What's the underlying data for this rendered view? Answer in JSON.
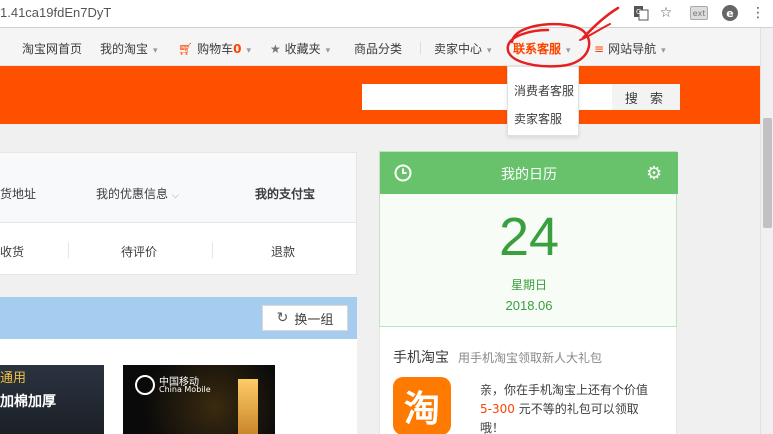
{
  "browser": {
    "url": "1.41ca19fdEn7DyT"
  },
  "topnav": {
    "home": "淘宝网首页",
    "my_taobao": "我的淘宝",
    "cart": "购物车",
    "cart_count": "0",
    "favorites": "收藏夹",
    "categories": "商品分类",
    "seller_center": "卖家中心",
    "contact_service": "联系客服",
    "site_nav": "网站导航"
  },
  "dropdown": {
    "items": [
      "消费者客服",
      "卖家客服"
    ]
  },
  "search": {
    "button_label": "搜 索",
    "placeholder": ""
  },
  "account_card": {
    "row1": [
      "货地址",
      "我的优惠信息",
      "我的支付宝"
    ],
    "row2": [
      "收货",
      "待评价",
      "退款"
    ]
  },
  "recommend": {
    "swap_label": "换一组",
    "thumb1_text1": "通用",
    "thumb1_text2": "加棉加厚",
    "thumb2_brand": "中国移动",
    "thumb2_brand_en": "China Mobile"
  },
  "calendar": {
    "title": "我的日历",
    "day": "24",
    "weekday": "星期日",
    "month": "2018.06"
  },
  "mobile_taobao": {
    "title": "手机淘宝",
    "subtitle": "用手机淘宝领取新人大礼包",
    "icon_char": "淘",
    "promo_before": "亲，你在手机淘宝上还有个价值",
    "promo_amount": "5-300",
    "promo_after": "元不等的礼包可以领取哦！"
  },
  "colors": {
    "brand_orange": "#ff5000",
    "accent": "#f40",
    "calendar_green": "#67c26b"
  }
}
